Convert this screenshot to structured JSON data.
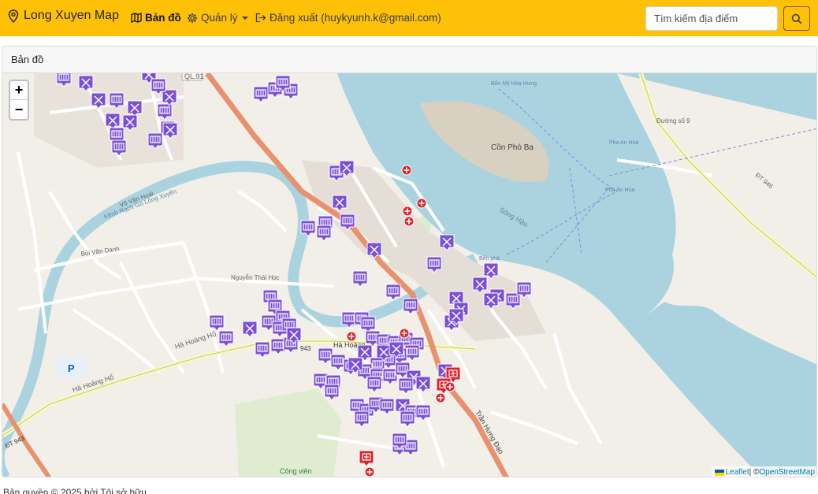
{
  "navbar": {
    "brand": "Long Xuyen Map",
    "map_link": "Bản đồ",
    "manage_link": "Quản lý",
    "logout_link": "Đăng xuất (huykyunh.k@gmail.com)",
    "search_placeholder": "Tìm kiếm địa điểm",
    "accent_color": "#ffc107"
  },
  "card": {
    "title": "Bản đồ"
  },
  "map": {
    "zoom_in": "+",
    "zoom_out": "−",
    "attribution_leaflet": "Leaflet",
    "attribution_sep": " | © ",
    "attribution_osm": "OpenStreetMap",
    "labels": {
      "ql91": "QL.91",
      "ben_mo": "Bến Mỹ Hòa Hưng",
      "con_pho_ba": "Cồn Phó Ba",
      "pha_an_hoa_1": "Pha An Hòa",
      "pha_an_hoa_2": "Phà An Hòa",
      "duong_so_9": "Đường số 9",
      "dt946": "ĐT 946",
      "ha_hoang_ho_1": "Hà Hoàng Hổ",
      "ha_hoang_ho_2": "Hà Hoàng Hổ",
      "ha_hoang": "Hà Hoàng",
      "route_943": "943",
      "dt943": "ĐT 943",
      "tran_hung_dao": "Trần Hưng Đạo",
      "cong_vien": "Công viên",
      "nguyen_thai_hoc": "Nguyễn Thái Học",
      "bui_van_danh": "Bùi Văn Danh",
      "vo_van_hoai": "Võ Văn Hoài",
      "song_hau": "Sông Hậu",
      "kenh_rach": "Kênh Rạch Gò Lông Xuyên",
      "ben_pha": "Bến phà",
      "p_label": "P"
    },
    "marker_colors": {
      "hotel": "#7b4fd6",
      "hospital": "#d9242d"
    }
  },
  "footer": {
    "text": "Bản quyền © 2025 bởi Tôi sở hữu"
  }
}
